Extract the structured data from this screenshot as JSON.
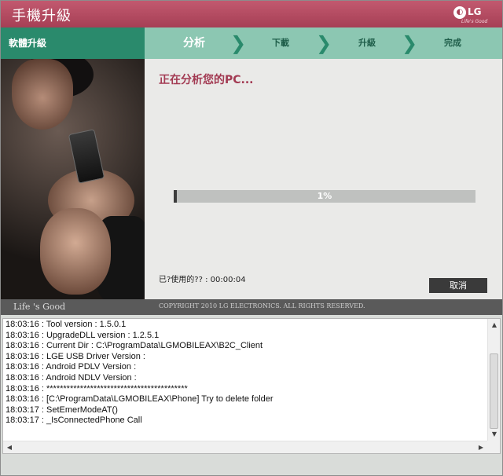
{
  "window": {
    "title": "手機升級"
  },
  "brand": {
    "logo_text": "LG",
    "logo_tagline": "Life's Good"
  },
  "steps": {
    "section_label": "軟體升級",
    "items": [
      {
        "label": "分析",
        "active": true
      },
      {
        "label": "下載",
        "active": false
      },
      {
        "label": "升級",
        "active": false
      },
      {
        "label": "完成",
        "active": false
      }
    ],
    "separator": "❯"
  },
  "main": {
    "status_title": "正在分析您的PC...",
    "progress": {
      "percent": 1,
      "label": "1%"
    },
    "elapsed_label": "已?使用的?? : 00:00:04",
    "cancel_label": "取消"
  },
  "footer": {
    "slogan": "Life 's Good",
    "copyright": "COPYRIGHT 2010 LG ELECTRONICS. ALL RIGHTS RESERVED."
  },
  "log": {
    "lines": [
      "18:03:16 : Tool version : 1.5.0.1",
      "18:03:16 : UpgradeDLL version : 1.2.5.1",
      "18:03:16 : Current Dir : C:\\ProgramData\\LGMOBILEAX\\B2C_Client",
      "18:03:16 : LGE USB Driver Version :",
      "18:03:16 : Android PDLV Version :",
      "18:03:16 : Android NDLV Version :",
      "18:03:16 : ******************************************",
      "18:03:16 : [C:\\ProgramData\\LGMOBILEAX\\Phone] Try to delete folder",
      "18:03:17 : SetEmerModeAT()",
      "18:03:17 : _IsConnectedPhone Call"
    ]
  },
  "colors": {
    "title_bar": "#a63f55",
    "step_bar": "#8cc7b2",
    "step_dark": "#2a8a6c",
    "status_text": "#a23a52"
  }
}
